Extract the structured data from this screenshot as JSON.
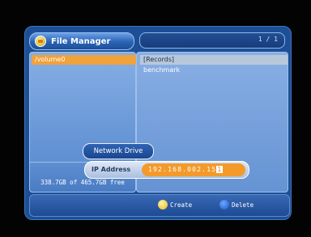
{
  "window": {
    "title": "File Manager",
    "page_indicator": "1 / 1"
  },
  "left_panel": {
    "selected_volume": "/volume0",
    "free_space": "338.7GB of 465.7GB free"
  },
  "right_panel": {
    "items": [
      "[Records]",
      "benchmark"
    ]
  },
  "network": {
    "button_label": "Network Drive",
    "ip_label": "IP Address",
    "ip_prefix": "192.168.002.15",
    "ip_cursor_digit": "1"
  },
  "footer": {
    "create_label": "Create",
    "delete_label": "Delete"
  },
  "icons": {
    "title": "folder-icon",
    "create": "yellow-key-icon",
    "delete": "blue-key-icon"
  },
  "colors": {
    "highlight": "#f0a23b",
    "panel": "#86aee4",
    "frame": "#1c4f96"
  }
}
